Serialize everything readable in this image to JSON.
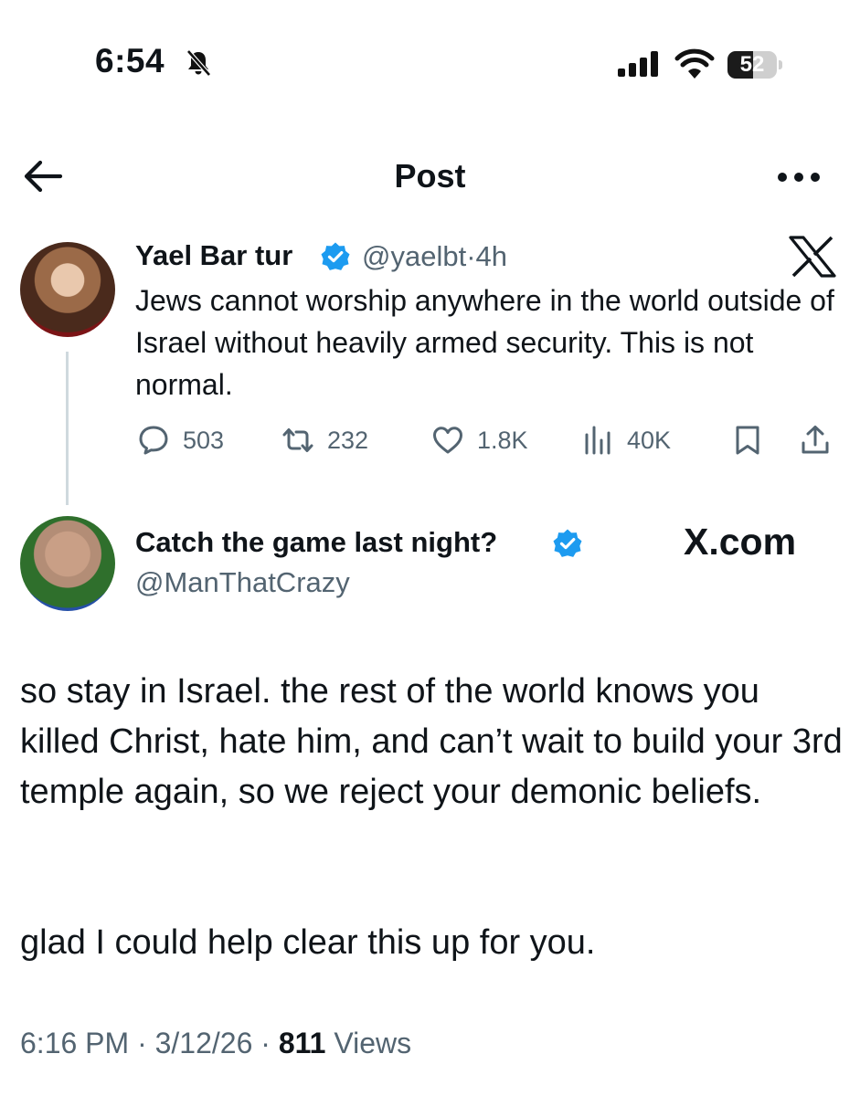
{
  "status_bar": {
    "time": "6:54",
    "battery_level": "52",
    "battery_fraction": 0.52
  },
  "header": {
    "title": "Post"
  },
  "quoted_post": {
    "author_name": "Yael Bar tur",
    "handle": "@yaelbt",
    "separator": "·",
    "time_ago": "4h",
    "text": "Jews cannot worship anywhere in the world outside of Israel without heavily armed security. This is not normal.",
    "stats": {
      "replies": "503",
      "reposts": "232",
      "likes": "1.8K",
      "views": "40K"
    }
  },
  "post": {
    "author_name": "Catch the game last night?",
    "handle": "@ManThatCrazy",
    "watermark": "X.com",
    "paragraph_1": "so stay in Israel. the rest of the world knows you killed Christ, hate him, and can’t wait to build your 3rd temple again, so we reject your demonic beliefs.",
    "paragraph_2": "glad I could help clear this up for you.",
    "timestamp": "6:16 PM · 3/12/26 · ",
    "views_count": "811",
    "views_label": " Views"
  },
  "colors": {
    "text": "#0f1419",
    "secondary": "#536471",
    "verified": "#1d9bf0",
    "thread_line": "#cfd9de"
  },
  "icons": [
    "bell-slash-icon",
    "signal-icon",
    "wifi-icon",
    "back-arrow-icon",
    "more-icon",
    "verified-badge-icon",
    "x-logo-icon",
    "reply-icon",
    "repost-icon",
    "like-icon",
    "views-icon",
    "bookmark-icon",
    "share-icon"
  ]
}
